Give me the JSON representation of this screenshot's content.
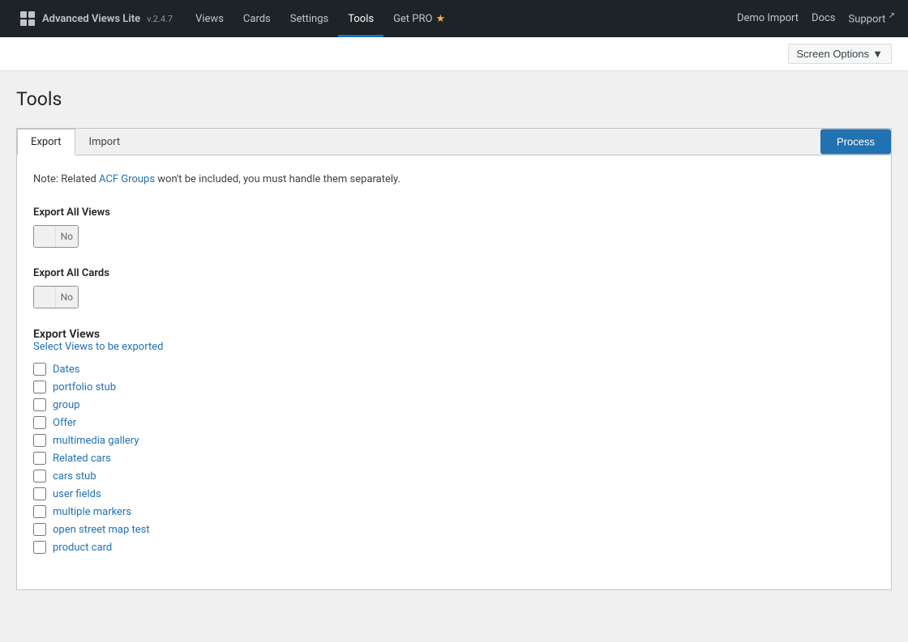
{
  "app": {
    "name": "Advanced Views Lite",
    "version": "v.2.4.7",
    "logo_icon": "grid"
  },
  "nav": {
    "items": [
      {
        "id": "views",
        "label": "Views",
        "active": false
      },
      {
        "id": "cards",
        "label": "Cards",
        "active": false
      },
      {
        "id": "settings",
        "label": "Settings",
        "active": false
      },
      {
        "id": "tools",
        "label": "Tools",
        "active": true
      },
      {
        "id": "getpro",
        "label": "Get PRO",
        "active": false,
        "star": true
      }
    ],
    "right_links": [
      {
        "id": "demo-import",
        "label": "Demo Import",
        "external": false
      },
      {
        "id": "docs",
        "label": "Docs",
        "external": false
      },
      {
        "id": "support",
        "label": "Support",
        "external": true
      }
    ]
  },
  "screen_options": {
    "label": "Screen Options",
    "arrow": "▼"
  },
  "page": {
    "title": "Tools"
  },
  "tabs": [
    {
      "id": "export",
      "label": "Export",
      "active": true
    },
    {
      "id": "import",
      "label": "Import",
      "active": false
    }
  ],
  "process_button": {
    "label": "Process"
  },
  "note": {
    "prefix": "Note: Related ",
    "link_text": "ACF Groups",
    "suffix": " won't be included, you must handle them separately."
  },
  "export_all_views": {
    "label": "Export All Views",
    "toggle_value": "No"
  },
  "export_all_cards": {
    "label": "Export All Cards",
    "toggle_value": "No"
  },
  "export_views_section": {
    "title": "Export Views",
    "subtitle": "Select Views to be exported",
    "items": [
      {
        "id": "dates",
        "label": "Dates"
      },
      {
        "id": "portfolio-stub",
        "label": "portfolio stub"
      },
      {
        "id": "group",
        "label": "group"
      },
      {
        "id": "offer",
        "label": "Offer"
      },
      {
        "id": "multimedia-gallery",
        "label": "multimedia gallery"
      },
      {
        "id": "related-cars",
        "label": "Related cars"
      },
      {
        "id": "cars-stub",
        "label": "cars stub"
      },
      {
        "id": "user-fields",
        "label": "user fields"
      },
      {
        "id": "multiple-markers",
        "label": "multiple markers"
      },
      {
        "id": "open-street-map-test",
        "label": "open street map test"
      },
      {
        "id": "product-card",
        "label": "product card"
      }
    ]
  }
}
